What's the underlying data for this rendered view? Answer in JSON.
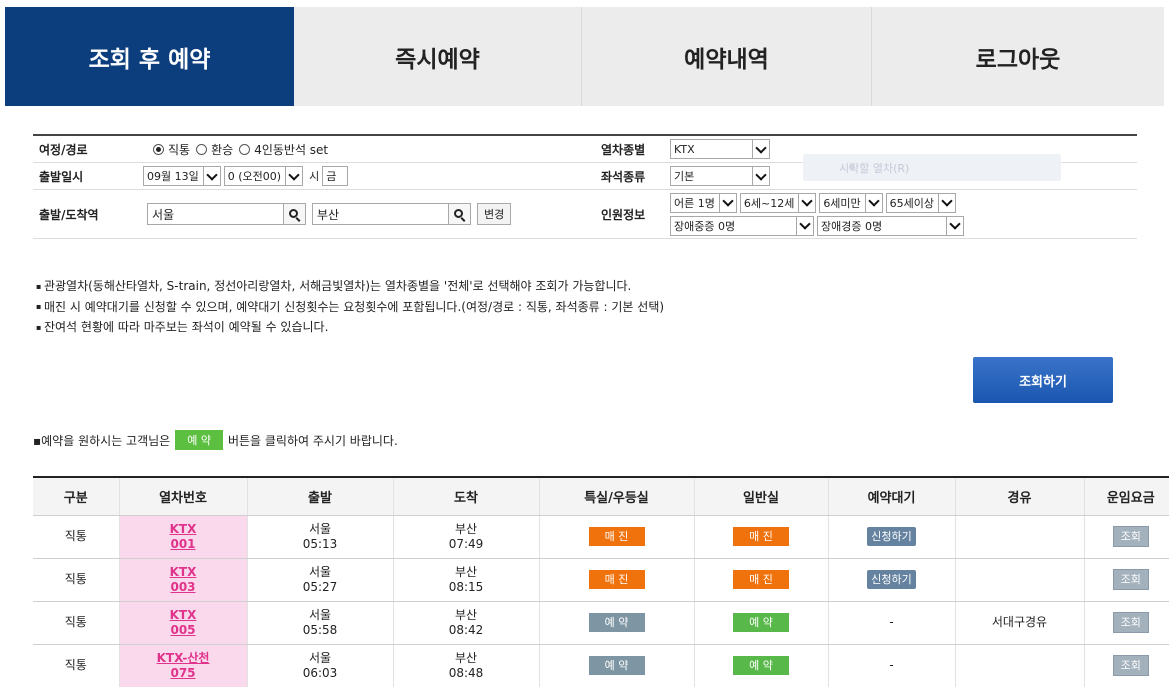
{
  "tabs": [
    {
      "label": "조회 후 예약",
      "active": true
    },
    {
      "label": "즉시예약",
      "active": false
    },
    {
      "label": "예약내역",
      "active": false
    },
    {
      "label": "로그아웃",
      "active": false
    }
  ],
  "form": {
    "route": {
      "label": "여정/경로",
      "options": [
        "직통",
        "환승",
        "4인동반석 set"
      ],
      "selected": "직통"
    },
    "train_type": {
      "label": "열차종별",
      "value": "KTX"
    },
    "depart_datetime": {
      "label": "출발일시",
      "date": "09월 13일",
      "hour": "0 (오전00)",
      "hour_suffix": "시",
      "weekday": "금"
    },
    "seat_type": {
      "label": "좌석종류",
      "value": "기본"
    },
    "stations": {
      "label": "출발/도착역",
      "depart": "서울",
      "arrive": "부산",
      "swap_label": "변경"
    },
    "passengers": {
      "label": "인원정보",
      "adult": "어른 1명",
      "child": "6세~12세",
      "infant": "6세미만",
      "senior": "65세이상",
      "disabled_severe": "장애중증 0명",
      "disabled_mild": "장애경증 0명"
    },
    "ghost_text": "시작할 열차(R)"
  },
  "notices": [
    "관광열차(동해산타열차, S-train, 정선아리랑열차, 서해금빛열차)는 열차종별을 '전체'로 선택해야 조회가 가능합니다.",
    "매진 시 예약대기를 신청할 수 있으며, 예약대기 신청횟수는 요청횟수에 포함됩니다.(여정/경로 : 직통, 좌석종류 : 기본 선택)",
    "잔여석 현황에 따라 마주보는 좌석이 예약될 수 있습니다."
  ],
  "search_button": "조회하기",
  "guide": {
    "prefix": "▪예약을 원하시는 고객님은",
    "badge": "예 약",
    "suffix": "버튼을 클릭하여 주시기 바랍니다."
  },
  "table": {
    "headers": [
      "구분",
      "열차번호",
      "출발",
      "도착",
      "특실/우등실",
      "일반실",
      "예약대기",
      "경유",
      "운임요금"
    ],
    "rows": [
      {
        "kind": "직통",
        "train1": "KTX",
        "train2": "001",
        "dep_stn": "서울",
        "dep_time": "05:13",
        "arr_stn": "부산",
        "arr_time": "07:49",
        "first": "매 진",
        "first_style": "sold",
        "std": "매 진",
        "std_style": "sold",
        "wait": "신청하기",
        "via": "",
        "fare": "조회"
      },
      {
        "kind": "직통",
        "train1": "KTX",
        "train2": "003",
        "dep_stn": "서울",
        "dep_time": "05:27",
        "arr_stn": "부산",
        "arr_time": "08:15",
        "first": "매 진",
        "first_style": "sold",
        "std": "매 진",
        "std_style": "sold",
        "wait": "신청하기",
        "via": "",
        "fare": "조회"
      },
      {
        "kind": "직통",
        "train1": "KTX",
        "train2": "005",
        "dep_stn": "서울",
        "dep_time": "05:58",
        "arr_stn": "부산",
        "arr_time": "08:42",
        "first": "예 약",
        "first_style": "gray",
        "std": "예 약",
        "std_style": "green",
        "wait": "-",
        "via": "서대구경유",
        "fare": "조회"
      },
      {
        "kind": "직통",
        "train1": "KTX-산천",
        "train2": "075",
        "dep_stn": "서울",
        "dep_time": "06:03",
        "arr_stn": "부산",
        "arr_time": "08:48",
        "first": "예 약",
        "first_style": "gray",
        "std": "예 약",
        "std_style": "green",
        "wait": "-",
        "via": "",
        "fare": "조회"
      }
    ]
  }
}
